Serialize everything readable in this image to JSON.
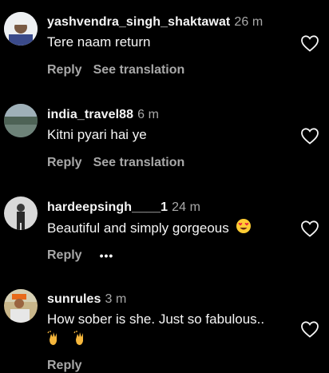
{
  "comments": [
    {
      "username": "yashvendra_singh_shaktawat",
      "time": "26 m",
      "text": "Tere naam return",
      "reply_label": "Reply",
      "translate_label": "See translation"
    },
    {
      "username": "india_travel88",
      "time": "6 m",
      "text": "Kitni pyari hai ye",
      "reply_label": "Reply",
      "translate_label": "See translation"
    },
    {
      "username": "hardeepsingh____1",
      "time": "24 m",
      "text": "Beautiful and simply gorgeous",
      "reply_label": "Reply",
      "more_label": "•••"
    },
    {
      "username": "sunrules",
      "time": "3 m",
      "text": "How sober is she. Just so fabulous..",
      "reply_label": "Reply"
    }
  ],
  "icons": {
    "heart": "heart-outline-icon",
    "heart_eyes_emoji": "heart-eyes-emoji",
    "raising_hands_emoji": "raising-hands-emoji"
  },
  "colors": {
    "background": "#000000",
    "primary_text": "#f5f5f5",
    "secondary_text": "#a8a8a8"
  }
}
